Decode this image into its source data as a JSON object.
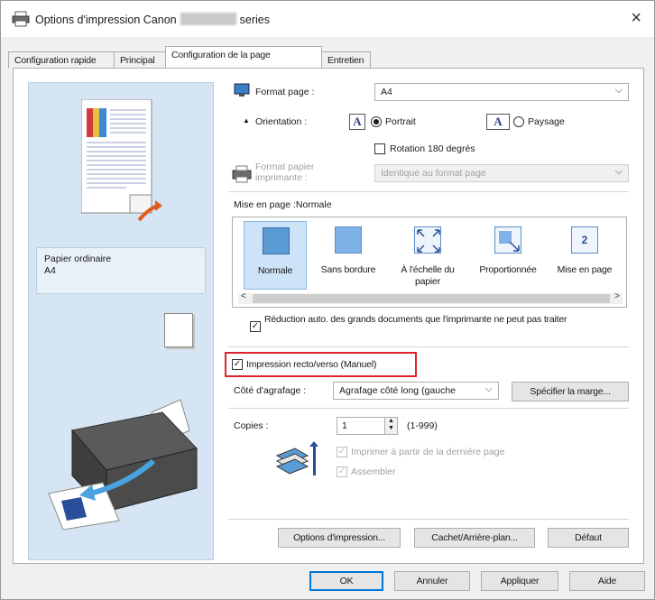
{
  "window": {
    "title_prefix": "Options d'impression Canon",
    "title_suffix": "series",
    "close": "×"
  },
  "tabs": [
    {
      "label": "Configuration rapide",
      "active": false
    },
    {
      "label": "Principal",
      "active": false
    },
    {
      "label": "Configuration de la page",
      "active": true
    },
    {
      "label": "Entretien",
      "active": false
    }
  ],
  "preview": {
    "paper_type": "Papier ordinaire",
    "paper_size": "A4"
  },
  "page_setup": {
    "format_label": "Format page :",
    "format_value": "A4",
    "orientation_label": "Orientation :",
    "portrait_label": "Portrait",
    "landscape_label": "Paysage",
    "rotation_label": "Rotation 180 degrés",
    "printer_paper_label_1": "Format papier",
    "printer_paper_label_2": "imprimante :",
    "printer_paper_value": "Identique au format page"
  },
  "layout": {
    "header": "Mise en page :Normale",
    "items": [
      {
        "label": "Normale"
      },
      {
        "label": "Sans bordure"
      },
      {
        "label": "À l'échelle du papier"
      },
      {
        "label": "Proportionnée"
      },
      {
        "label": "Mise en page"
      }
    ],
    "item4_badge": "2",
    "scroll_left": "<",
    "scroll_right": ">"
  },
  "options": {
    "auto_reduce": "Réduction auto. des grands documents que l'imprimante ne peut pas traiter",
    "duplex_label": "Impression recto/verso (Manuel)",
    "stapling_label": "Côté d'agrafage :",
    "stapling_value": "Agrafage côté long (gauche",
    "margin_button": "Spécifier la marge...",
    "copies_label": "Copies :",
    "copies_value": "1",
    "copies_range": "(1-999)",
    "print_last_first": "Imprimer à partir de la dernière page",
    "collate": "Assembler"
  },
  "bottom_buttons": {
    "print_options": "Options d'impression...",
    "stamp_background": "Cachet/Arrière-plan...",
    "default": "Défaut"
  },
  "dialog_buttons": {
    "ok": "OK",
    "cancel": "Annuler",
    "apply": "Appliquer",
    "help": "Aide"
  },
  "colors": {
    "accent": "#0078d7",
    "highlight": "#e0232a",
    "preview_bg": "#d5e5f3"
  }
}
